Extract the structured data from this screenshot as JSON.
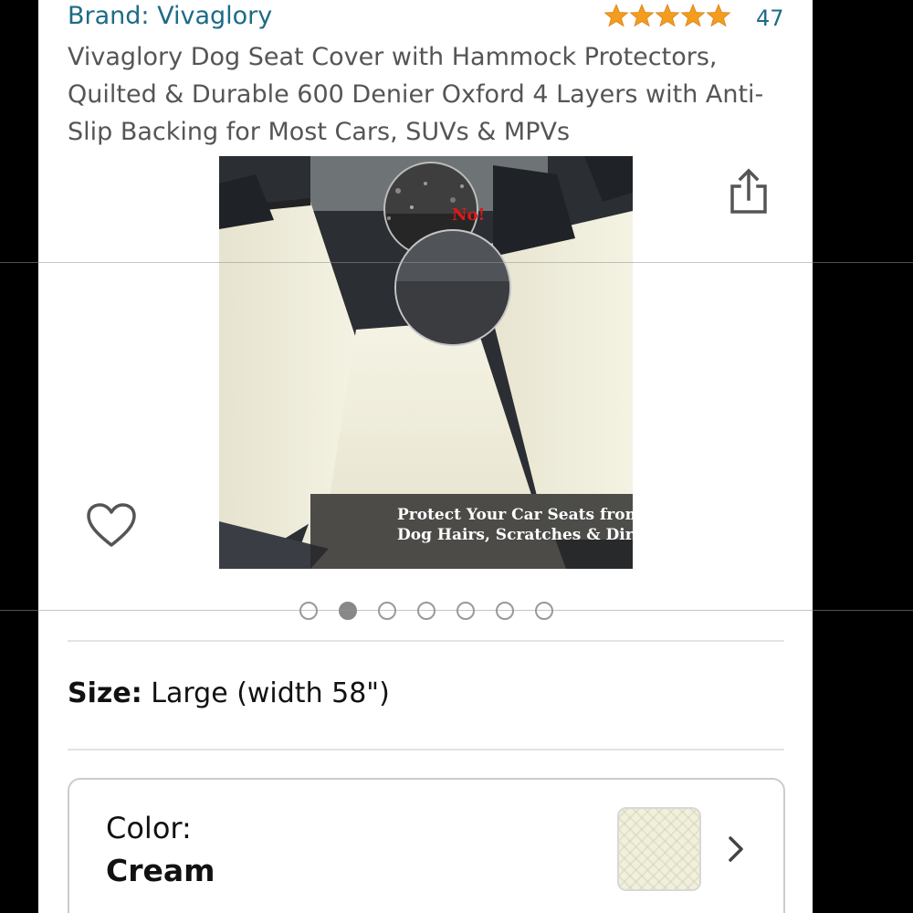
{
  "product": {
    "brand": "Brand: Vivaglory",
    "rating_count": "47",
    "rating_stars": 5,
    "title": "Vivaglory Dog Seat Cover with Hammock Protectors, Quilted & Durable 600 Denier Oxford 4 Layers with Anti-Slip Backing for Most Cars, SUVs & MPVs"
  },
  "image": {
    "badge": "No!",
    "caption_line1": "Protect Your Car Seats from",
    "caption_line2": "Dog Hairs, Scratches & Dirt"
  },
  "carousel": {
    "count": 7,
    "active_index": 1
  },
  "size": {
    "label": "Size:",
    "value": "Large (width 58\")"
  },
  "color": {
    "label": "Color:",
    "value": "Cream",
    "swatch_color": "#f1f0dc"
  },
  "colors": {
    "link": "#1c6b86",
    "star": "#f39c1e",
    "title": "#555555"
  },
  "icons": {
    "share": "share-icon",
    "wishlist": "heart-icon",
    "chevron": "chevron-right-icon"
  }
}
